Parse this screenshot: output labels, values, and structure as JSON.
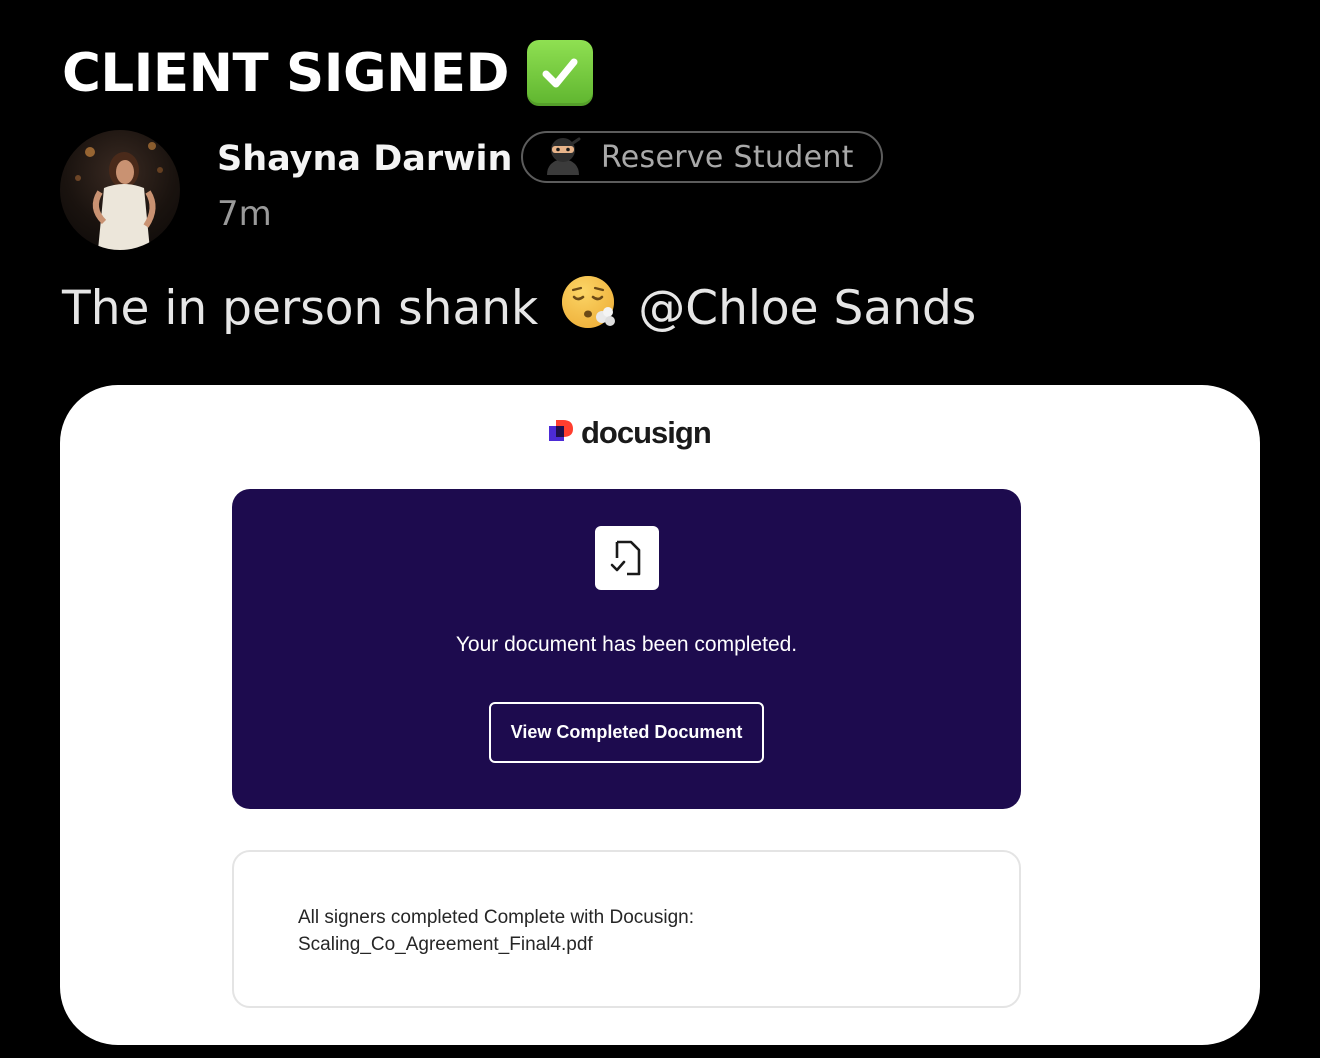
{
  "post": {
    "title": "CLIENT SIGNED",
    "title_icon": "white-check-mark-emoji",
    "author": {
      "name": "Shayna Darwin",
      "badge_icon": "ninja-emoji",
      "badge_label": "Reserve Student",
      "time_ago": "7m"
    },
    "body": {
      "text": "The in person shank",
      "emoji": "face-exhaling-emoji",
      "mention": "@Chloe Sands"
    }
  },
  "attachment": {
    "logo_text": "docusign",
    "message": "Your document has been completed.",
    "button_label": "View Completed Document",
    "info_line_1": "All signers completed Complete with Docusign:",
    "info_line_2": "Scaling_Co_Agreement_Final4.pdf"
  },
  "colors": {
    "background": "#000000",
    "docusign_card": "#1d0b4e",
    "check_green": "#6cc43a"
  }
}
